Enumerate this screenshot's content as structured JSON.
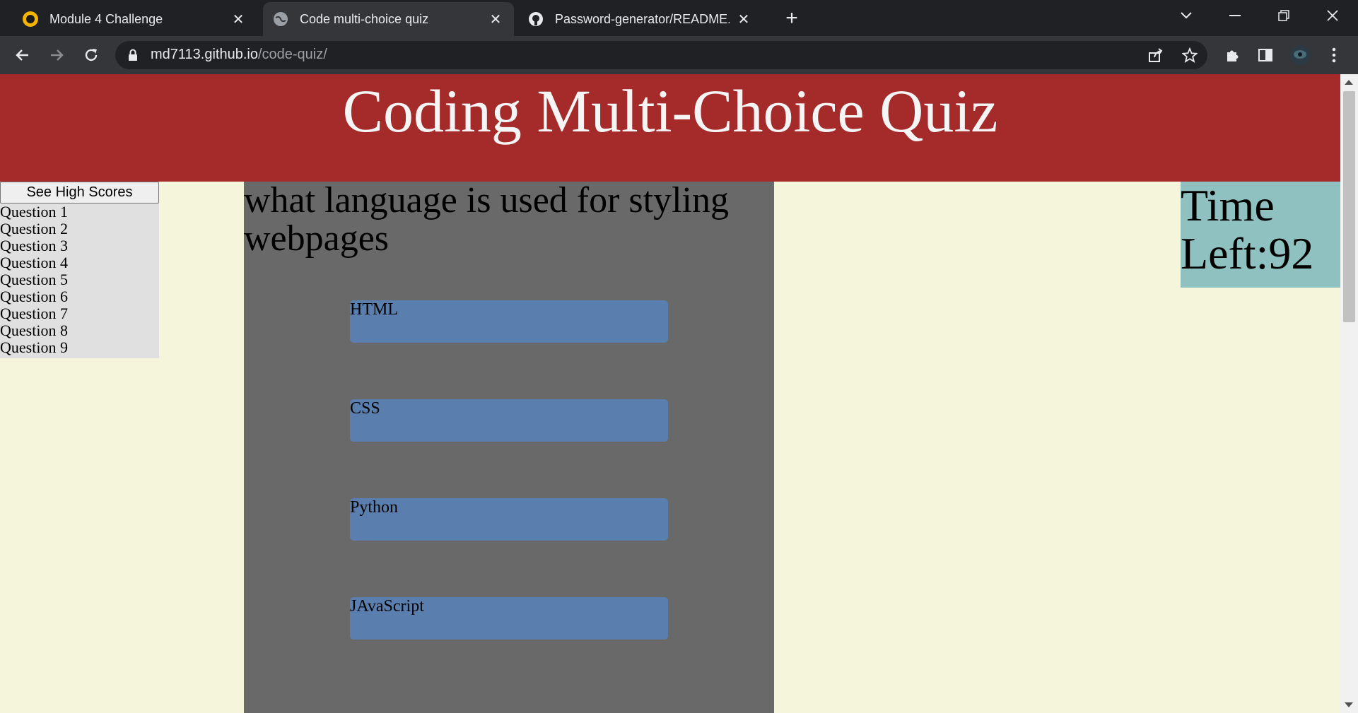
{
  "browser": {
    "tabs": [
      {
        "title": "Module 4 Challenge",
        "icon": "module-favicon"
      },
      {
        "title": "Code multi-choice quiz",
        "icon": "globe-icon",
        "active": true
      },
      {
        "title": "Password-generator/README.md",
        "icon": "github-icon"
      }
    ],
    "url_host": "md7113.github.io",
    "url_path": "/code-quiz/"
  },
  "page": {
    "title": "Coding Multi-Choice Quiz",
    "high_scores_label": "See High Scores",
    "questions": [
      "Question 1",
      "Question 2",
      "Question 3",
      "Question 4",
      "Question 5",
      "Question 6",
      "Question 7",
      "Question 8",
      "Question 9"
    ],
    "current_question": "what language is used for styling webpages",
    "answers": [
      "HTML",
      "CSS",
      "Python",
      "JAvaScript"
    ],
    "timer_label": "Time Left:",
    "timer_value": "92"
  },
  "colors": {
    "header": "#a52a2a",
    "background": "#f5f5dc",
    "panel": "#696969",
    "answer": "#5a7fae",
    "timer": "#8fc1c1"
  }
}
